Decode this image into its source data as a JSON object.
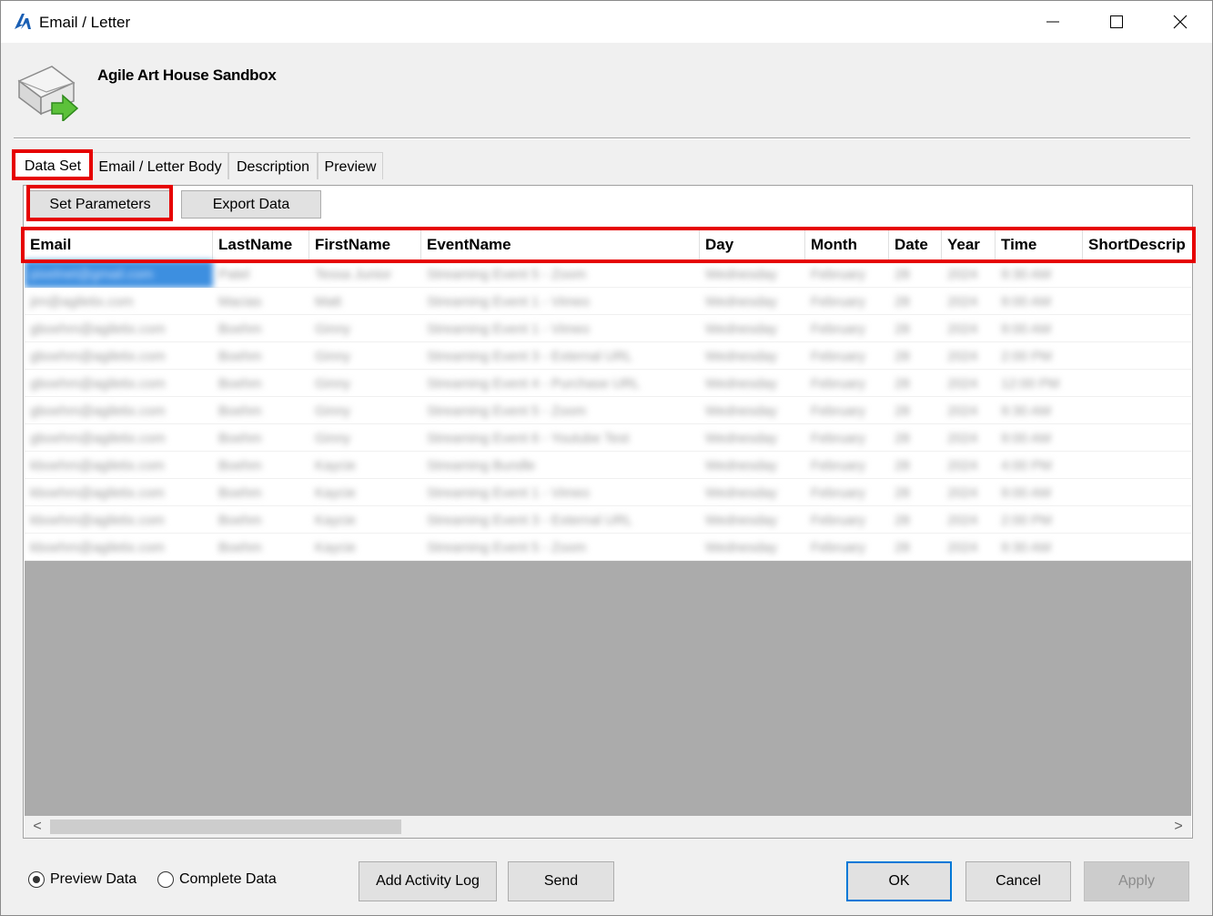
{
  "window": {
    "title": "Email / Letter",
    "controls": {
      "minimize": "minimize",
      "maximize": "maximize",
      "close": "close"
    }
  },
  "header": {
    "company": "Agile Art House Sandbox"
  },
  "tabs": [
    {
      "label": "Data Set",
      "active": true
    },
    {
      "label": "Email / Letter Body"
    },
    {
      "label": "Description"
    },
    {
      "label": "Preview"
    }
  ],
  "toolbar": {
    "set_parameters": "Set Parameters",
    "export_data": "Export Data"
  },
  "grid": {
    "columns": [
      "Email",
      "LastName",
      "FirstName",
      "EventName",
      "Day",
      "Month",
      "Date",
      "Year",
      "Time",
      "ShortDescrip"
    ],
    "rows": [
      [
        "pixelnet@gmail.com",
        "Patel",
        "Tessa Junior",
        "Streaming Event 5 - Zoom",
        "Wednesday",
        "February",
        "28",
        "2024",
        "9:30 AM",
        ""
      ],
      [
        "jim@agiletix.com",
        "Macias",
        "Matt",
        "Streaming Event 1 - Vimeo",
        "Wednesday",
        "February",
        "28",
        "2024",
        "9:00 AM",
        ""
      ],
      [
        "gboehm@agiletix.com",
        "Boehm",
        "Ginny",
        "Streaming Event 1 - Vimeo",
        "Wednesday",
        "February",
        "28",
        "2024",
        "9:00 AM",
        ""
      ],
      [
        "gboehm@agiletix.com",
        "Boehm",
        "Ginny",
        "Streaming Event 3 - External URL",
        "Wednesday",
        "February",
        "28",
        "2024",
        "2:00 PM",
        ""
      ],
      [
        "gboehm@agiletix.com",
        "Boehm",
        "Ginny",
        "Streaming Event 4 - Purchase URL",
        "Wednesday",
        "February",
        "28",
        "2024",
        "12:00 PM",
        ""
      ],
      [
        "gboehm@agiletix.com",
        "Boehm",
        "Ginny",
        "Streaming Event 5 - Zoom",
        "Wednesday",
        "February",
        "28",
        "2024",
        "9:30 AM",
        ""
      ],
      [
        "gboehm@agiletix.com",
        "Boehm",
        "Ginny",
        "Streaming Event 6 - Youtube Test",
        "Wednesday",
        "February",
        "28",
        "2024",
        "9:00 AM",
        ""
      ],
      [
        "kboehm@agiletix.com",
        "Boehm",
        "Kaycie",
        "Streaming Bundle",
        "Wednesday",
        "February",
        "28",
        "2024",
        "4:00 PM",
        ""
      ],
      [
        "kboehm@agiletix.com",
        "Boehm",
        "Kaycie",
        "Streaming Event 1 - Vimeo",
        "Wednesday",
        "February",
        "28",
        "2024",
        "9:00 AM",
        ""
      ],
      [
        "kboehm@agiletix.com",
        "Boehm",
        "Kaycie",
        "Streaming Event 3 - External URL",
        "Wednesday",
        "February",
        "28",
        "2024",
        "2:00 PM",
        ""
      ],
      [
        "kboehm@agiletix.com",
        "Boehm",
        "Kaycie",
        "Streaming Event 5 - Zoom",
        "Wednesday",
        "February",
        "28",
        "2024",
        "9:30 AM",
        ""
      ]
    ]
  },
  "scroll": {
    "left_arrow": "<",
    "right_arrow": ">"
  },
  "footer": {
    "preview_data": "Preview Data",
    "complete_data": "Complete Data",
    "add_activity_log": "Add Activity Log",
    "send": "Send",
    "ok": "OK",
    "cancel": "Cancel",
    "apply": "Apply"
  },
  "colors": {
    "highlight": "#e60000",
    "selection": "#3d8fe0",
    "grid_empty": "#ababab",
    "ok_border": "#0078d7"
  }
}
